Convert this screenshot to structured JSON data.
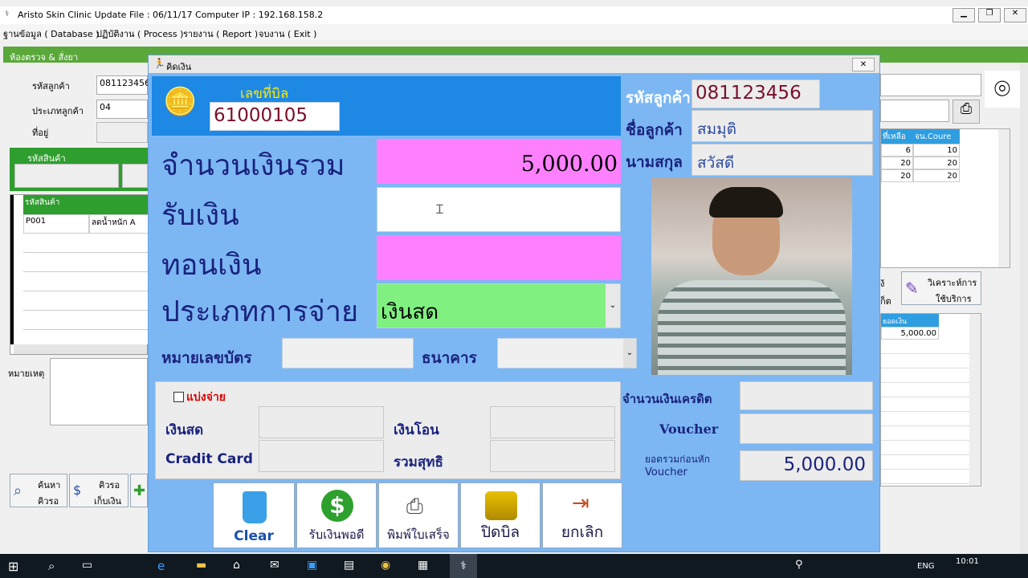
{
  "window": {
    "title": "Aristo Skin Clinic  Update File : 06/11/17 Computer  IP : 192.168.158.2"
  },
  "menu": [
    "ฐานข้อมูล ( Database )",
    "ปฏิบัติงาน ( Process )",
    "รายงาน ( Report )",
    "จบงาน ( Exit )"
  ],
  "background_form": {
    "section_title": "ห้องตรวจ & สั่งยา",
    "customer_code_label": "รหัสลูกค้า",
    "customer_code_value": "081123456",
    "customer_type_label": "ประเภทลูกค้า",
    "customer_type_value": "04",
    "address_label": "ที่อยู่",
    "product_code_header": "รหัสสินค้า",
    "grid_header": "รหัสสินค้า",
    "grid_row_code": "P001",
    "grid_row_name": "ลดน้ำหนัก A",
    "remark_label": "หมายเหตุ",
    "search_btn": [
      "ค้นหา",
      "คิวรอ"
    ],
    "queue_btn": [
      "คิวรอ",
      "เก็บเงิน"
    ],
    "right_grid_headers": [
      "ที่เหลือ",
      "จน.Coure"
    ],
    "right_grid_rows": [
      [
        "6",
        "10"
      ],
      [
        "20",
        "20"
      ],
      [
        "20",
        "20"
      ]
    ],
    "analyze_btn": [
      "วิเคราะห์การ",
      "ใช้บริการ"
    ],
    "analyze_left": [
      "ง้",
      "ก็ต"
    ],
    "balance_header": "ยอดเงิน",
    "balance_value": "5,000.00"
  },
  "dialog": {
    "title": "คิดเงิน",
    "bill_no_label": "เลขที่บิล",
    "bill_no_value": "61000105",
    "total_label": "จำนวนเงินรวม",
    "total_value": "5,000.00",
    "receive_label": "รับเงิน",
    "receive_value": "",
    "change_label": "ทอนเงิน",
    "change_value": "",
    "paytype_label": "ประเภทการจ่าย",
    "paytype_value": "เงินสด",
    "card_no_label": "หมายเลขบัตร",
    "bank_label": "ธนาคาร",
    "split_label": "แบ่งจ่าย",
    "cash_label": "เงินสด",
    "transfer_label": "เงินโอน",
    "credit_label": "Cradit Card",
    "net_label": "รวมสุทธิ",
    "cust_code_label": "รหัสลูกค้า",
    "cust_code_value": "081123456",
    "cust_name_label": "ชื่อลูกค้า",
    "cust_name_value": "สมมุติ",
    "cust_surname_label": "นามสกุล",
    "cust_surname_value": "สวัสดี",
    "credit_amount_label": "จำนวนเงินเครดิต",
    "voucher_label": "Voucher",
    "pre_voucher_label_1": "ยอดรวมก่อนหัก",
    "pre_voucher_label_2": "Voucher",
    "pre_voucher_value": "5,000.00",
    "buttons": {
      "clear": "Clear",
      "exact": "รับเงินพอดี",
      "print": "พิมพ์ใบเสร็จ",
      "close_bill": "ปิดบิล",
      "cancel": "ยกเลิก"
    }
  },
  "taskbar": {
    "lang": "ENG",
    "time": "10:01"
  },
  "colors": {
    "dialog_bg": "#7cb7f3",
    "header_blue": "#1e88e5",
    "pink": "#ff80ff",
    "green_select": "#80f080",
    "green_bar": "#5aa83a"
  }
}
